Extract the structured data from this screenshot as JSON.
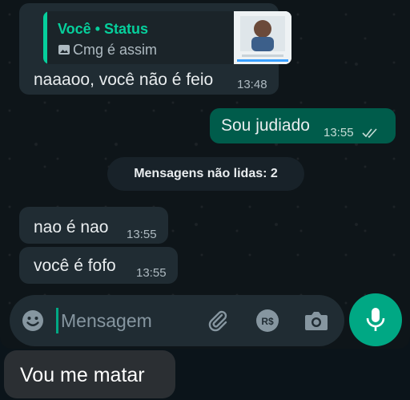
{
  "quote": {
    "author": "Você • Status",
    "caption": "Cmg é assim"
  },
  "messages": [
    {
      "text": "naaaoo, você não é feio",
      "time": "13:48"
    },
    {
      "text": "Sou judiado",
      "time": "13:55"
    },
    {
      "text": "nao é nao",
      "time": "13:55"
    },
    {
      "text": "você é fofo",
      "time": "13:55"
    }
  ],
  "unread_label": "Mensagens não lidas: 2",
  "composer": {
    "placeholder": "Mensagem"
  },
  "bottom_text": "Vou me matar",
  "colors": {
    "accent": "#00a884",
    "incoming": "#202c33",
    "outgoing": "#005c4b",
    "quote_author": "#06cf9c"
  },
  "icons": [
    "emoji-icon",
    "attach-icon",
    "payment-icon",
    "camera-icon",
    "mic-icon",
    "double-check-icon",
    "photo-icon"
  ]
}
